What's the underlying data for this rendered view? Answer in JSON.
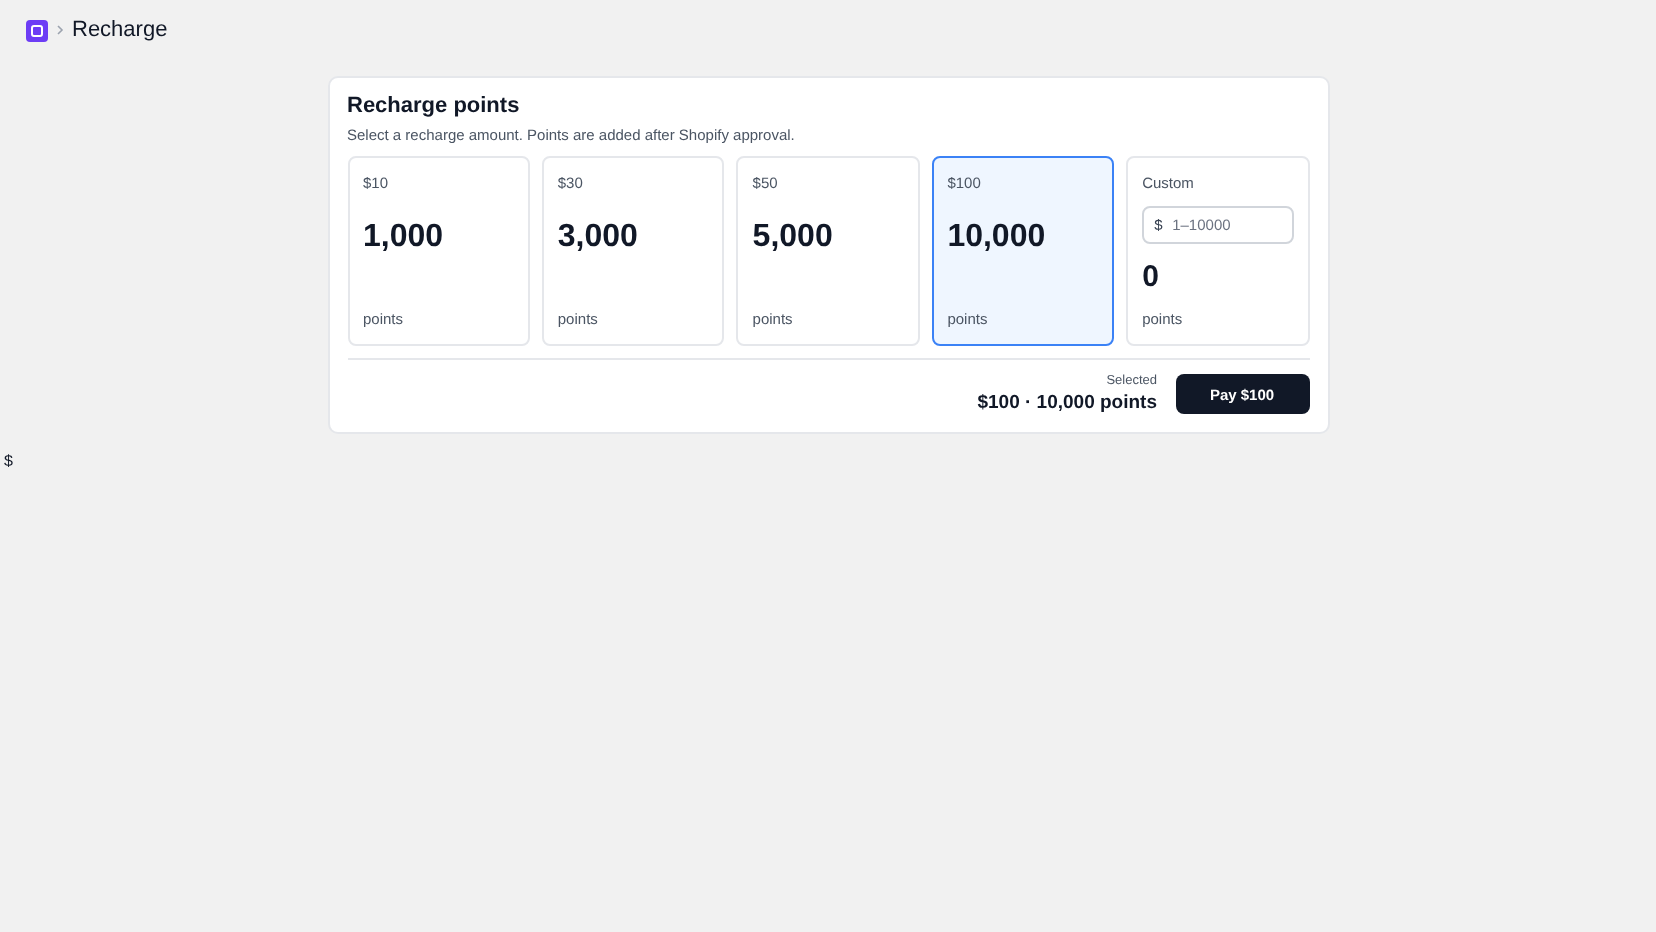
{
  "header": {
    "title": "Recharge"
  },
  "card": {
    "title": "Recharge points",
    "subtitle": "Select a recharge amount. Points are added after Shopify approval."
  },
  "options": [
    {
      "kind": "preset",
      "price": "$10",
      "points": "1,000",
      "unit": "points",
      "selected": false
    },
    {
      "kind": "preset",
      "price": "$30",
      "points": "3,000",
      "unit": "points",
      "selected": false
    },
    {
      "kind": "preset",
      "price": "$50",
      "points": "5,000",
      "unit": "points",
      "selected": false
    },
    {
      "kind": "preset",
      "price": "$100",
      "points": "10,000",
      "unit": "points",
      "selected": true
    },
    {
      "kind": "custom",
      "price": "Custom",
      "prefix": "$",
      "placeholder": "1–10000",
      "points": "0",
      "unit": "points",
      "selected": false
    }
  ],
  "footer": {
    "label": "Selected",
    "summary": "$100 · 10,000 points",
    "button": "Pay $100"
  },
  "stray_text": "$"
}
